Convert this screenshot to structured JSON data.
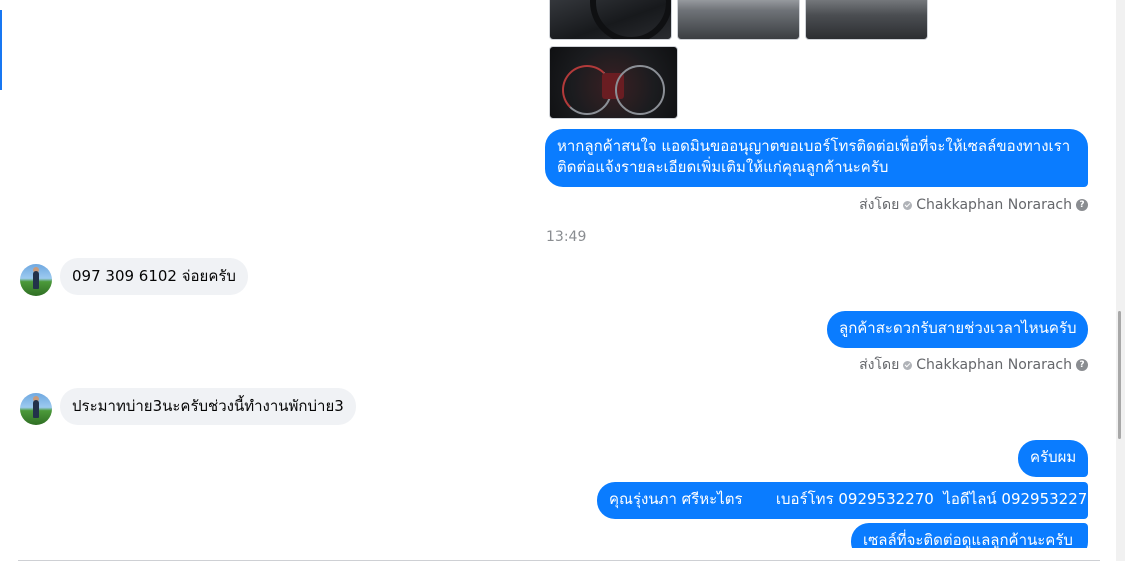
{
  "messages": {
    "outgoing_request": "หากลูกค้าสนใจ แอดมินขออนุญาตขอเบอร์โทรติดต่อเพื่อที่จะให้เซลล์ของทางเรา",
    "outgoing_request_line2": "ติดต่อแจ้งรายละเอียดเพิ่มเติมให้แก่คุณลูกค้านะครับ",
    "timestamp": "13:49",
    "incoming_phone": "097 309 6102 จ่อยครับ",
    "outgoing_question": "ลูกค้าสะดวกรับสายช่วงเวลาไหนครับ",
    "incoming_time": "ประมาทบ่าย3นะครับช่วงนี้ทำงานพักบ่าย3",
    "outgoing_ok": "ครับผม",
    "outgoing_contact": "คุณรุ่งนภา ศรีหะไตร       เบอร์โทร 0929532270  ไอดีไลน์ 0929532270",
    "outgoing_partial": "เซลล์ที่จะติดต่อดูแลลูกค้านะครับ"
  },
  "sent_by": {
    "prefix": "ส่งโดย",
    "name": "Chakkaphan Norarach"
  },
  "icons": {
    "verified": "check-circle-icon",
    "help": "question-circle-icon"
  },
  "colors": {
    "outgoing_bubble": "#0a7cff",
    "incoming_bubble": "#f0f2f5",
    "accent": "#1877f2"
  }
}
